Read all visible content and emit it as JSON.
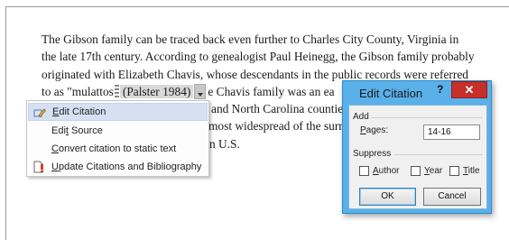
{
  "document": {
    "line1": "The Gibson family can be traced back even further to Charles City County, Virginia in",
    "line2": "the late 17th century. According to genealogist Paul Heinegg, the Gibson family probably",
    "line3": "originated with Elizabeth Chavis, whose descendants in the public records were referred",
    "line4_start": "to as \"mulattos",
    "citation": "(Palster 1984)",
    "line4_end": "e Chavis family was an ea",
    "line5_end": "and North Carolina countie",
    "line6_end": "most widespread of the surr",
    "line7_end": "n U.S."
  },
  "context_menu": {
    "items": [
      {
        "label_prefix": "",
        "underline": "E",
        "label_rest": "dit Citation",
        "icon": "edit-citation-icon"
      },
      {
        "label_prefix": "Edi",
        "underline": "t",
        "label_rest": " Source",
        "icon": ""
      },
      {
        "label_prefix": "",
        "underline": "C",
        "label_rest": "onvert citation to static text",
        "icon": ""
      },
      {
        "label_prefix": "",
        "underline": "U",
        "label_rest": "pdate Citations and Bibliography",
        "icon": "update-bibliography-icon"
      }
    ]
  },
  "dialog": {
    "title": "Edit Citation",
    "help": "?",
    "close": "✕",
    "add_label": "Add",
    "pages_label_u": "P",
    "pages_label_rest": "ages:",
    "pages_value": "14-16",
    "suppress_label": "Suppress",
    "author_u": "A",
    "author_rest": "uthor",
    "year_u": "Y",
    "year_rest": "ear",
    "title_u": "T",
    "title_rest": "itle",
    "ok": "OK",
    "cancel": "Cancel"
  },
  "colors": {
    "dialog_frame": "#5ab0e8",
    "close_button": "#c7302a",
    "menu_hover": "#d5e1f2",
    "citation_field": "#d9d9d9"
  }
}
